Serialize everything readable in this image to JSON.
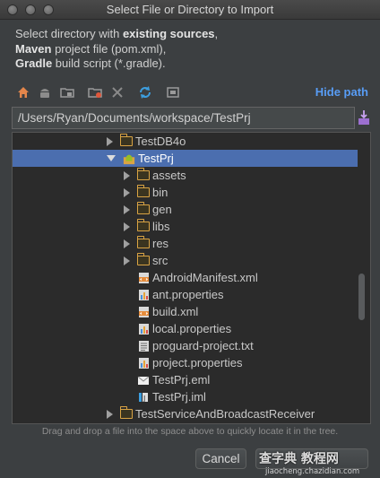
{
  "window": {
    "title": "Select File or Directory to Import"
  },
  "description": {
    "line1_prefix": "Select directory with ",
    "line1_bold": "existing sources",
    "line1_suffix": ",",
    "line2_bold": "Maven",
    "line2_rest": " project file (pom.xml),",
    "line3_bold": "Gradle",
    "line3_rest": " build script (*.gradle)."
  },
  "toolbar": {
    "icons": [
      "home-icon",
      "android-icon",
      "project-folder-icon",
      "new-folder-icon",
      "delete-icon",
      "refresh-icon",
      "show-hidden-icon"
    ],
    "hide_path_label": "Hide path"
  },
  "path_field": {
    "value": "/Users/Ryan/Documents/workspace/TestPrj"
  },
  "tree": {
    "items": [
      {
        "label": "TestDB4o",
        "type": "folder",
        "expanded": false,
        "depth": 0
      },
      {
        "label": "TestPrj",
        "type": "android-module",
        "expanded": true,
        "depth": 0,
        "selected": true
      },
      {
        "label": "assets",
        "type": "folder",
        "expanded": false,
        "depth": 1
      },
      {
        "label": "bin",
        "type": "folder",
        "expanded": false,
        "depth": 1
      },
      {
        "label": "gen",
        "type": "folder",
        "expanded": false,
        "depth": 1
      },
      {
        "label": "libs",
        "type": "folder",
        "expanded": false,
        "depth": 1
      },
      {
        "label": "res",
        "type": "folder",
        "expanded": false,
        "depth": 1
      },
      {
        "label": "src",
        "type": "folder",
        "expanded": false,
        "depth": 1
      },
      {
        "label": "AndroidManifest.xml",
        "type": "xml-file",
        "depth": 1
      },
      {
        "label": "ant.properties",
        "type": "properties-file",
        "depth": 1
      },
      {
        "label": "build.xml",
        "type": "xml-file",
        "depth": 1
      },
      {
        "label": "local.properties",
        "type": "properties-file",
        "depth": 1
      },
      {
        "label": "proguard-project.txt",
        "type": "text-file",
        "depth": 1
      },
      {
        "label": "project.properties",
        "type": "properties-file",
        "depth": 1
      },
      {
        "label": "TestPrj.eml",
        "type": "eml-file",
        "depth": 1
      },
      {
        "label": "TestPrj.iml",
        "type": "iml-file",
        "depth": 1
      },
      {
        "label": "TestServiceAndBroadcastReceiver",
        "type": "folder",
        "expanded": false,
        "depth": 0
      }
    ]
  },
  "hint": "Drag and drop a file into the space above to quickly locate it in the tree.",
  "buttons": {
    "cancel": "Cancel"
  },
  "watermark": {
    "main": "查字典 教程网",
    "sub": "jiaocheng.chazidian.com"
  },
  "colors": {
    "accent": "#589df6",
    "selection": "#4b6eaf",
    "folder": "#d9a343",
    "background": "#3c3f41"
  }
}
